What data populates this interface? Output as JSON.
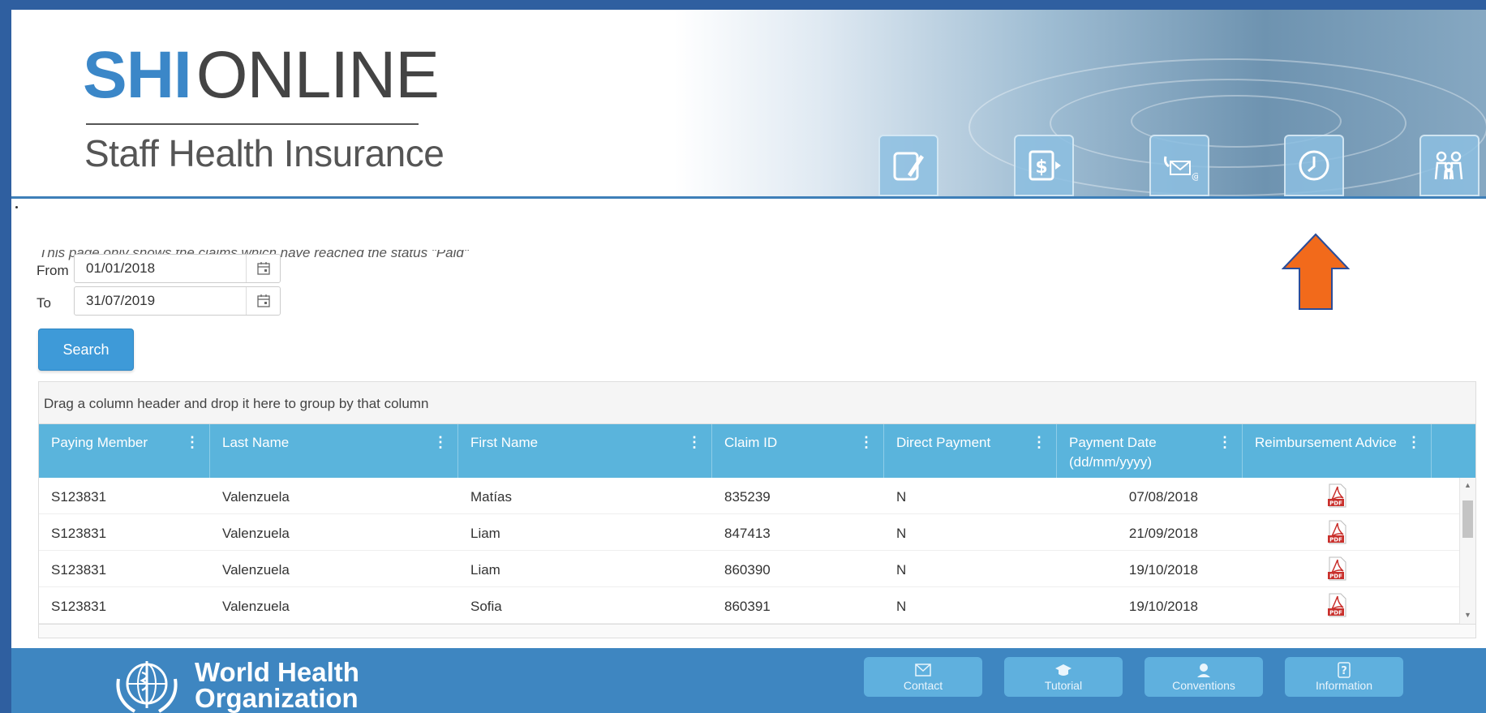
{
  "header": {
    "logo_shi": "SHI",
    "logo_online": "ONLINE",
    "logo_subtitle": "Staff Health Insurance",
    "nav_icons": [
      "claim-form-icon",
      "payment-icon",
      "contact-mail-icon",
      "history-icon",
      "family-icon"
    ]
  },
  "page": {
    "notice": "This page only shows the claims which have reached the status \"Paid\"",
    "from_label": "From",
    "from_value": "01/01/2018",
    "to_label": "To",
    "to_value": "31/07/2019",
    "search_label": "Search"
  },
  "grid": {
    "group_hint": "Drag a column header and drop it here to group by that column",
    "columns": [
      {
        "label": "Paying Member",
        "sub": ""
      },
      {
        "label": "Last Name",
        "sub": ""
      },
      {
        "label": "First Name",
        "sub": ""
      },
      {
        "label": "Claim ID",
        "sub": ""
      },
      {
        "label": "Direct Payment",
        "sub": ""
      },
      {
        "label": "Payment Date",
        "sub": "(dd/mm/yyyy)"
      },
      {
        "label": "Reimbursement Advice",
        "sub": ""
      }
    ],
    "rows": [
      {
        "member": "S123831",
        "last": "Valenzuela",
        "first": "Matías",
        "claim": "835239",
        "direct": "N",
        "date": "07/08/2018",
        "advice": "PDF"
      },
      {
        "member": "S123831",
        "last": "Valenzuela",
        "first": "Liam",
        "claim": "847413",
        "direct": "N",
        "date": "21/09/2018",
        "advice": "PDF"
      },
      {
        "member": "S123831",
        "last": "Valenzuela",
        "first": "Liam",
        "claim": "860390",
        "direct": "N",
        "date": "19/10/2018",
        "advice": "PDF"
      },
      {
        "member": "S123831",
        "last": "Valenzuela",
        "first": "Sofia",
        "claim": "860391",
        "direct": "N",
        "date": "19/10/2018",
        "advice": "PDF"
      }
    ]
  },
  "footer": {
    "org_line1": "World Health",
    "org_line2": "Organization",
    "buttons": [
      {
        "label": "Contact",
        "icon": "envelope-icon"
      },
      {
        "label": "Tutorial",
        "icon": "graduation-cap-icon"
      },
      {
        "label": "Conventions",
        "icon": "handshake-icon"
      },
      {
        "label": "Information",
        "icon": "question-icon"
      }
    ]
  },
  "colors": {
    "brand_blue": "#3b87c8",
    "grid_header": "#5ab4dc",
    "footer": "#3e86c1",
    "annotation_arrow": "#f26a1b"
  }
}
